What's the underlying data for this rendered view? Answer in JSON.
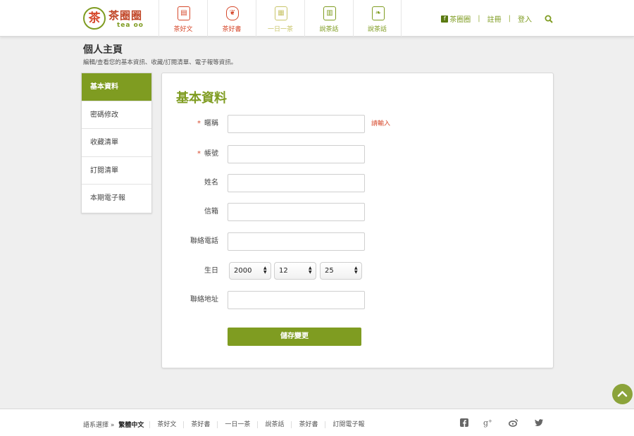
{
  "header": {
    "logo_mark": "茶",
    "logo_text": "茶圈圈",
    "logo_sub": "tea oo",
    "nav": [
      {
        "label": "茶好文",
        "icon": "document-icon",
        "glyph": "▤",
        "color": "#d6492c"
      },
      {
        "label": "茶好書",
        "icon": "book-icon",
        "glyph": "❦",
        "color": "#d6492c"
      },
      {
        "label": "一日一茶",
        "icon": "calendar-icon",
        "glyph": "▦",
        "color": "#c9c56a"
      },
      {
        "label": "說茶話",
        "icon": "page-icon",
        "glyph": "▥",
        "color": "#7f9c21"
      },
      {
        "label": "說茶話",
        "icon": "leaf-book-icon",
        "glyph": "❧",
        "color": "#7f9c21"
      }
    ],
    "fb_link": "茶圈圈",
    "register": "註冊",
    "login": "登入"
  },
  "page": {
    "title": "個人主頁",
    "subtitle": "編輯/查看您的基本資訊、收藏/訂閱清單、電子報等資訊。"
  },
  "side_menu": [
    {
      "label": "基本資料",
      "active": true
    },
    {
      "label": "密碼修改",
      "active": false
    },
    {
      "label": "收藏清單",
      "active": false
    },
    {
      "label": "訂閱清單",
      "active": false
    },
    {
      "label": "本期電子報",
      "active": false
    }
  ],
  "form": {
    "title": "基本資料",
    "required_mark": "*",
    "nickname": {
      "label": "暱稱",
      "value": "",
      "hint": "請輸入"
    },
    "account": {
      "label": "帳號",
      "value": ""
    },
    "name": {
      "label": "姓名",
      "value": ""
    },
    "email": {
      "label": "信箱",
      "value": ""
    },
    "phone": {
      "label": "聯絡電話",
      "value": ""
    },
    "birthday": {
      "label": "生日",
      "year": "2000",
      "month": "12",
      "day": "25"
    },
    "address": {
      "label": "聯絡地址",
      "value": ""
    },
    "save_label": "儲存變更"
  },
  "footer": {
    "lang_label": "語系選擇 »",
    "lang_current": "繁體中文",
    "links": [
      "茶好文",
      "茶好書",
      "一日一茶",
      "說茶話",
      "茶好書",
      "訂閱電子報"
    ]
  },
  "colors": {
    "accent": "#7f9c21",
    "alert": "#d6492c"
  }
}
